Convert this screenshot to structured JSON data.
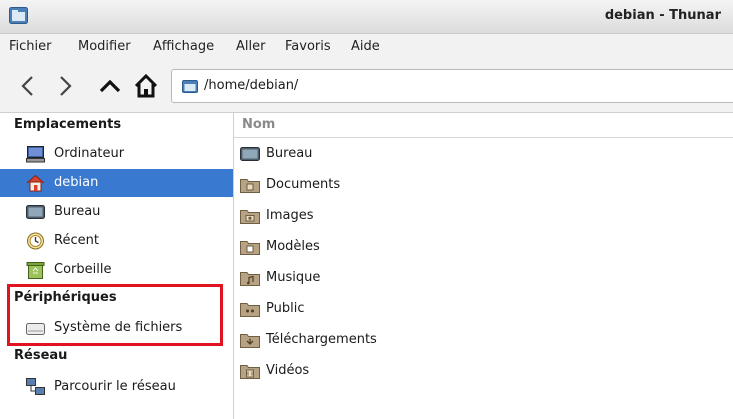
{
  "window": {
    "title": "debian - Thunar"
  },
  "menu": [
    "Fichier",
    "Modifier",
    "Affichage",
    "Aller",
    "Favoris",
    "Aide"
  ],
  "location": {
    "path": "/home/debian/"
  },
  "sidebar": {
    "sections": [
      {
        "header": "Emplacements"
      },
      {
        "header": "Périphériques"
      },
      {
        "header": "Réseau"
      }
    ],
    "items": [
      {
        "label": "Ordinateur",
        "icon": "computer-icon"
      },
      {
        "label": "debian",
        "icon": "home-icon",
        "selected": true
      },
      {
        "label": "Bureau",
        "icon": "desktop-icon"
      },
      {
        "label": "Récent",
        "icon": "clock-icon"
      },
      {
        "label": "Corbeille",
        "icon": "trash-icon"
      },
      {
        "label": "Système de fichiers",
        "icon": "drive-icon"
      },
      {
        "label": "Parcourir le réseau",
        "icon": "network-icon"
      }
    ]
  },
  "files": {
    "column": "Nom",
    "rows": [
      {
        "name": "Bureau",
        "icon": "desktop-folder-icon"
      },
      {
        "name": "Documents",
        "icon": "documents-folder-icon"
      },
      {
        "name": "Images",
        "icon": "pictures-folder-icon"
      },
      {
        "name": "Modèles",
        "icon": "templates-folder-icon"
      },
      {
        "name": "Musique",
        "icon": "music-folder-icon"
      },
      {
        "name": "Public",
        "icon": "public-folder-icon"
      },
      {
        "name": "Téléchargements",
        "icon": "downloads-folder-icon"
      },
      {
        "name": "Vidéos",
        "icon": "videos-folder-icon"
      }
    ]
  },
  "colors": {
    "selection": "#3a79d0",
    "highlight": "#e0141e",
    "folder": "#b7a384"
  }
}
